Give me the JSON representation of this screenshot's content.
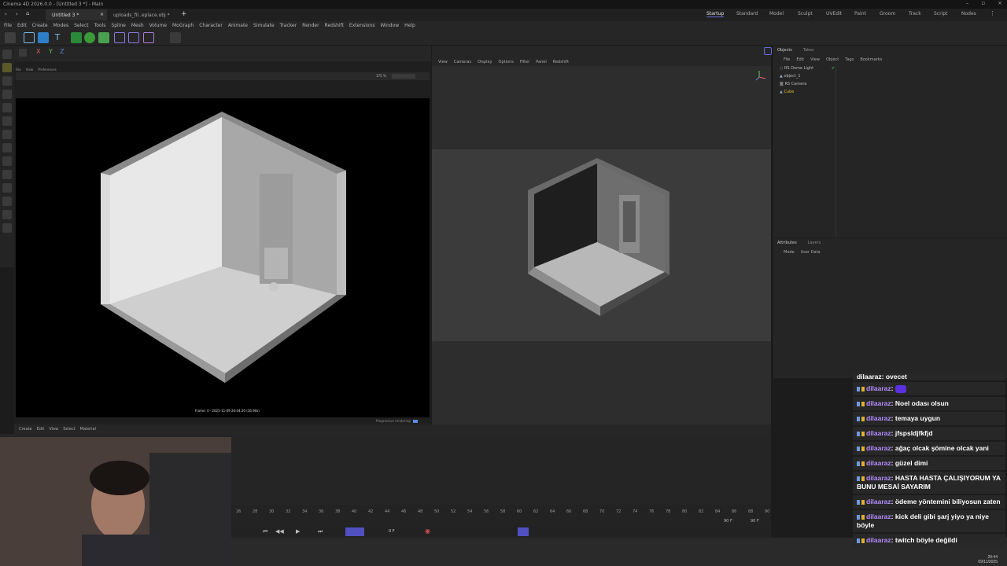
{
  "window": {
    "title": "Cinema 4D 2026.0.0 - [Untitled 3 *] - Main"
  },
  "doc_tabs": [
    "Untitled 3 *",
    "uploads_fil..eplace.obj *"
  ],
  "layout_tabs": [
    "Startup",
    "Standard",
    "Model",
    "Sculpt",
    "UVEdit",
    "Paint",
    "Groom",
    "Track",
    "Script",
    "Nodes"
  ],
  "active_layout": "Startup",
  "menu": [
    "File",
    "Edit",
    "Create",
    "Modes",
    "Select",
    "Tools",
    "Spline",
    "Mesh",
    "Volume",
    "MoGraph",
    "Character",
    "Animate",
    "Simulate",
    "Tracker",
    "Render",
    "Redshift",
    "Extensions",
    "Window",
    "Help"
  ],
  "render_view": {
    "menu": [
      "File",
      "View",
      "Preferences"
    ],
    "zoom": "175 %",
    "frame_info": "Frame: 0 · 2025-11-09 20:44:20 (16.90s)",
    "progressive_label": "Progressive rendering"
  },
  "viewport": {
    "menu": [
      "View",
      "Cameras",
      "Display",
      "Options",
      "Filter",
      "Panel",
      "Redshift"
    ]
  },
  "objects_panel": {
    "tabs": [
      "Objects",
      "Takes"
    ],
    "menu": [
      "File",
      "Edit",
      "View",
      "Object",
      "Tags",
      "Bookmarks"
    ],
    "items": [
      {
        "name": "RS Dome Light",
        "color": "#bbbbbb"
      },
      {
        "name": "object_1",
        "color": "#bbbbbb"
      },
      {
        "name": "RS Camera",
        "color": "#bbbbbb"
      },
      {
        "name": "Cube",
        "color": "#e0c030"
      }
    ]
  },
  "attributes_panel": {
    "tabs": [
      "Attributes",
      "Layers"
    ],
    "menu": [
      "Mode",
      "User Data"
    ]
  },
  "materials": {
    "menu": [
      "Create",
      "Edit",
      "View",
      "Select",
      "Material"
    ]
  },
  "timeline": {
    "ticks": [
      "26",
      "28",
      "30",
      "32",
      "34",
      "36",
      "38",
      "40",
      "42",
      "44",
      "46",
      "48",
      "50",
      "52",
      "54",
      "56",
      "58",
      "60",
      "62",
      "64",
      "66",
      "68",
      "70",
      "72",
      "74",
      "76",
      "78",
      "80",
      "82",
      "84",
      "86",
      "88",
      "90"
    ],
    "current_frame": "0 F",
    "end_frame_a": "90 F",
    "end_frame_b": "90 F"
  },
  "chat": {
    "partial_top": "dilaaraz: ovecet",
    "messages": [
      {
        "user": "dilaaraz",
        "text": ""
      },
      {
        "user": "dilaaraz",
        "text": "Noel odası olsun"
      },
      {
        "user": "dilaaraz",
        "text": "temaya uygun"
      },
      {
        "user": "dilaaraz",
        "text": "jfspsldjfkfjd"
      },
      {
        "user": "dilaaraz",
        "text": "ağaç olcak şömine olcak yani"
      },
      {
        "user": "dilaaraz",
        "text": "güzel dimi"
      },
      {
        "user": "dilaaraz",
        "text": "HASTA HASTA ÇALIŞIYORUM YA BUNU MESAİ SAYARIM"
      },
      {
        "user": "dilaaraz",
        "text": "ödeme yöntemini biliyosun zaten"
      },
      {
        "user": "dilaaraz",
        "text": "kick deli gibi şarj yiyo ya niye böyle"
      },
      {
        "user": "dilaaraz",
        "text": "twitch böyle değildi"
      }
    ],
    "user_color": "#b48cff"
  },
  "clock": {
    "time": "20:44",
    "date": "09/11/2025"
  },
  "colors": {
    "accent": "#6a6ae0",
    "toolbar_highlight": "#5050c0"
  }
}
